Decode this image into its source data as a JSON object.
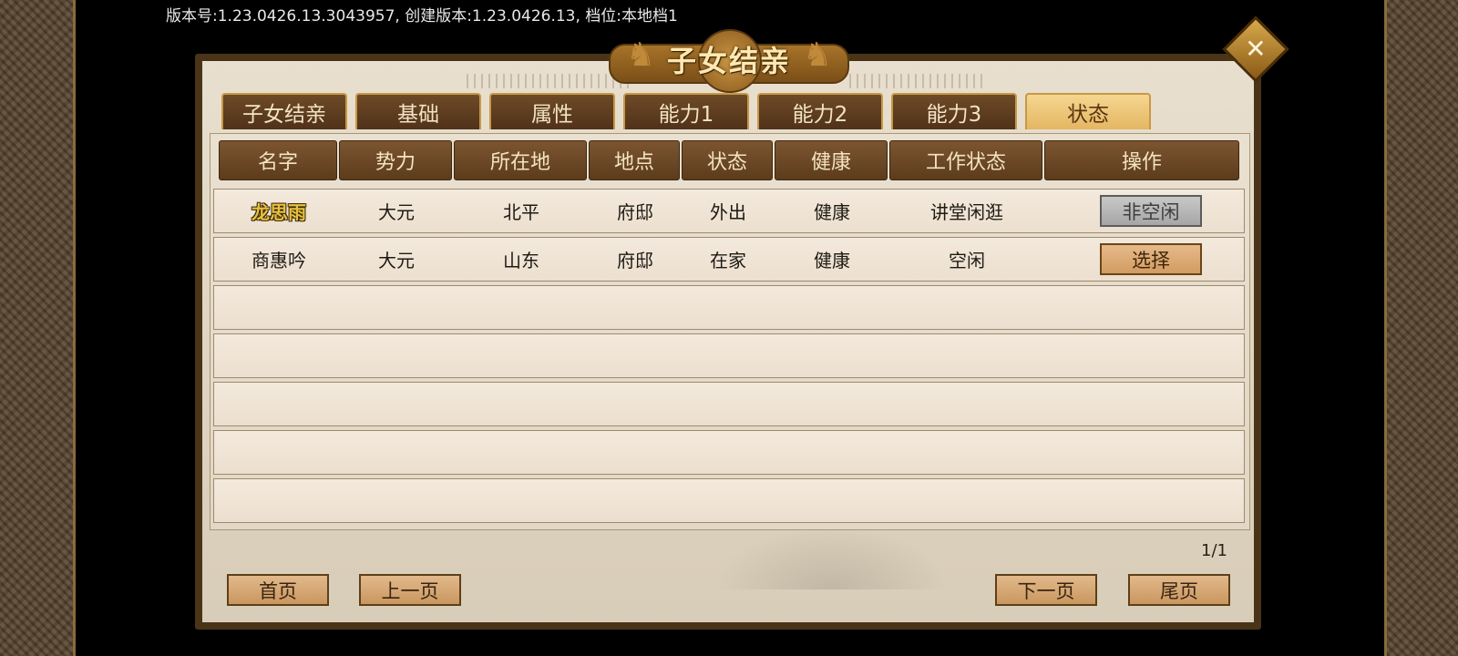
{
  "version_text": "版本号:1.23.0426.13.3043957,  创建版本:1.23.0426.13, 档位:本地档1",
  "title": "子女结亲",
  "tabs": [
    {
      "label": "子女结亲",
      "active": false
    },
    {
      "label": "基础",
      "active": false
    },
    {
      "label": "属性",
      "active": false
    },
    {
      "label": "能力1",
      "active": false
    },
    {
      "label": "能力2",
      "active": false
    },
    {
      "label": "能力3",
      "active": false
    },
    {
      "label": "状态",
      "active": true
    }
  ],
  "columns": [
    "名字",
    "势力",
    "所在地",
    "地点",
    "状态",
    "健康",
    "工作状态",
    "操作"
  ],
  "rows": [
    {
      "name": "龙思雨",
      "faction": "大元",
      "region": "北平",
      "place": "府邸",
      "status": "外出",
      "health": "健康",
      "work": "讲堂闲逛",
      "action": "非空闲",
      "action_state": "disabled"
    },
    {
      "name": "商惠吟",
      "faction": "大元",
      "region": "山东",
      "place": "府邸",
      "status": "在家",
      "health": "健康",
      "work": "空闲",
      "action": "选择",
      "action_state": "enabled"
    }
  ],
  "empty_rows": 5,
  "page_indicator": "1/1",
  "nav": {
    "first": "首页",
    "prev": "上一页",
    "next": "下一页",
    "last": "尾页"
  },
  "close_icon": "close-icon",
  "colors": {
    "header_bg": "#6b4726",
    "tab_active": "#f0c878",
    "highlight_name": "#e8c040"
  }
}
